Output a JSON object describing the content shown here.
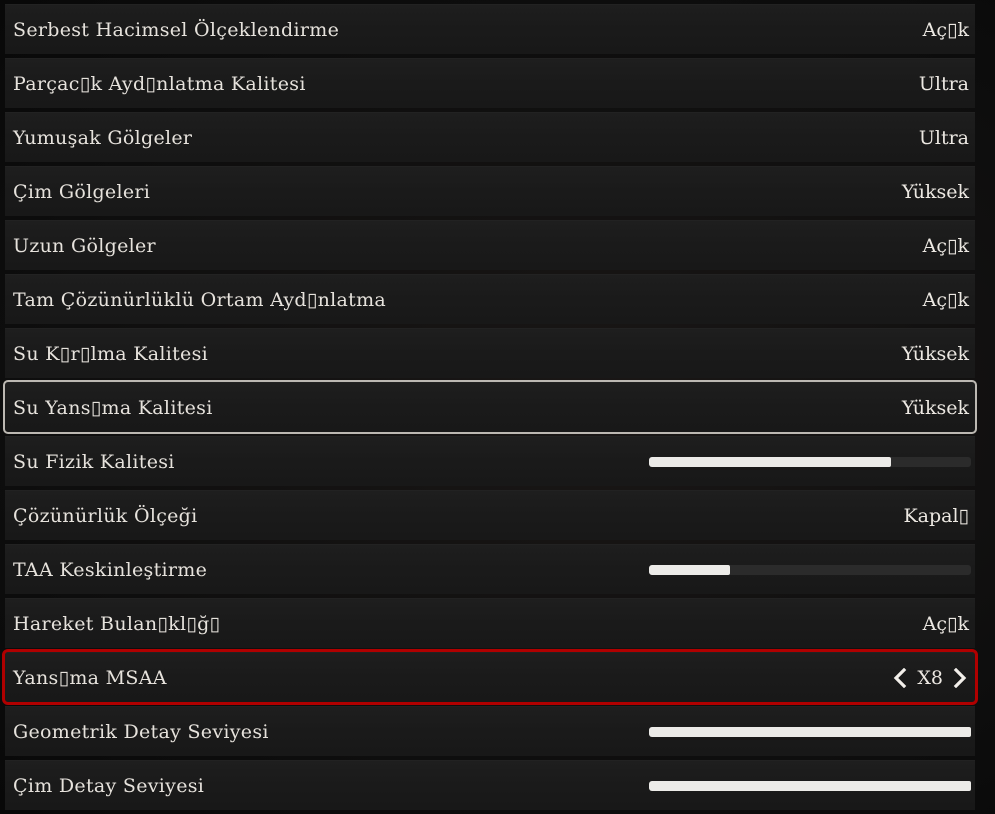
{
  "settings": [
    {
      "label": "Serbest Hacimsel Ölçeklendirme",
      "value": "Aç▯k",
      "type": "text"
    },
    {
      "label": "Parçac▯k Ayd▯nlatma Kalitesi",
      "value": "Ultra",
      "type": "text"
    },
    {
      "label": "Yumuşak Gölgeler",
      "value": "Ultra",
      "type": "text"
    },
    {
      "label": "Çim Gölgeleri",
      "value": "Yüksek",
      "type": "text"
    },
    {
      "label": "Uzun Gölgeler",
      "value": "Aç▯k",
      "type": "text"
    },
    {
      "label": "Tam Çözünürlüklü Ortam Ayd▯nlatma",
      "value": "Aç▯k",
      "type": "text"
    },
    {
      "label": "Su K▯r▯lma Kalitesi",
      "value": "Yüksek",
      "type": "text"
    },
    {
      "label": "Su Yans▯ma Kalitesi",
      "value": "Yüksek",
      "type": "text",
      "state": "hovered"
    },
    {
      "label": "Su Fizik Kalitesi",
      "type": "slider",
      "level": 0.75
    },
    {
      "label": "Çözünürlük Ölçeği",
      "value": "Kapal▯",
      "type": "text"
    },
    {
      "label": "TAA Keskinleştirme",
      "type": "slider",
      "level": 0.25
    },
    {
      "label": "Hareket Bulan▯kl▯ğ▯",
      "value": "Aç▯k",
      "type": "text"
    },
    {
      "label": "Yans▯ma MSAA",
      "value": "X8",
      "type": "stepper",
      "state": "selected"
    },
    {
      "label": "Geometrik Detay Seviyesi",
      "type": "slider",
      "level": 1.0
    },
    {
      "label": "Çim Detay Seviyesi",
      "type": "slider",
      "level": 1.0
    }
  ],
  "colors": {
    "selected_outline": "#b00000",
    "hover_outline": "#bcb8b2",
    "slider_fill": "#ecebe8",
    "slider_track": "#2b2b2b",
    "text": "#e6e2dc"
  },
  "icons": {
    "stepper_left": "chevron-left-icon",
    "stepper_right": "chevron-right-icon"
  }
}
